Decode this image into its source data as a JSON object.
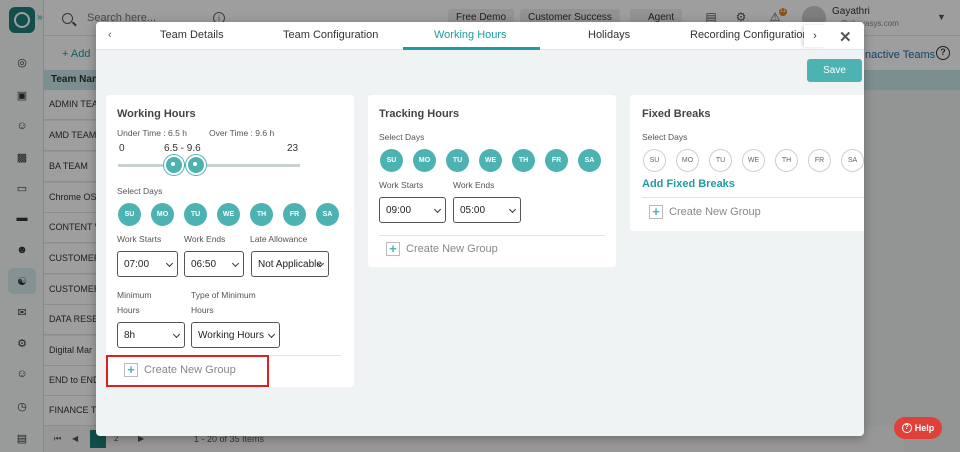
{
  "app": {
    "search_placeholder": "Search here...",
    "top_pills": [
      "Free Demo",
      "Customer Success",
      "Agent"
    ],
    "notif_count": "11",
    "user_name": "Gayathri",
    "user_email": "@shavasys.com",
    "add_label": "+ Add",
    "inactive_link": "Inactive Teams",
    "table_header": "Team Name",
    "rows": [
      "ADMIN TEAM",
      "AMD TEAM",
      "BA TEAM",
      "Chrome OS",
      "CONTENT W",
      "CUSTOMER",
      "CUSTOMER",
      "DATA RESEA",
      "Digital Mar",
      "END to END",
      "FINANCE TE"
    ],
    "pager": {
      "page1": "1",
      "page2": "2",
      "info": "1 - 20 of 35 Items"
    },
    "help_label": "Help"
  },
  "modal": {
    "tabs": [
      "Team Details",
      "Team Configuration",
      "Working Hours",
      "Holidays",
      "Recording Configuration"
    ],
    "active_tab": "Working Hours",
    "save_label": "Save",
    "working": {
      "title": "Working Hours",
      "under_time": "Under Time : 6.5 h",
      "over_time": "Over Time : 9.6 h",
      "slider_min": "0",
      "slider_range": "6.5 - 9.6",
      "slider_max": "23",
      "select_days": "Select Days",
      "days": [
        "SU",
        "MO",
        "TU",
        "WE",
        "TH",
        "FR",
        "SA"
      ],
      "work_starts_label": "Work Starts",
      "work_ends_label": "Work Ends",
      "late_label": "Late Allowance",
      "work_starts": "07:00",
      "work_ends": "06:50",
      "late": "Not Applicable",
      "min_hours_label_1": "Minimum",
      "min_hours_label_2": "Hours",
      "type_min_label_1": "Type of Minimum",
      "type_min_label_2": "Hours",
      "min_hours": "8h",
      "type_min": "Working Hours",
      "create_group": "Create New Group"
    },
    "tracking": {
      "title": "Tracking Hours",
      "select_days": "Select Days",
      "days": [
        "SU",
        "MO",
        "TU",
        "WE",
        "TH",
        "FR",
        "SA"
      ],
      "work_starts_label": "Work Starts",
      "work_ends_label": "Work Ends",
      "work_starts": "09:00",
      "work_ends": "05:00",
      "create_group": "Create New Group"
    },
    "fixed": {
      "title": "Fixed Breaks",
      "select_days": "Select Days",
      "days": [
        "SU",
        "MO",
        "TU",
        "WE",
        "TH",
        "FR",
        "SA"
      ],
      "add_label": "Add Fixed Breaks",
      "create_group": "Create New Group"
    }
  },
  "colors": {
    "accent": "#4db3b2",
    "brand": "#1e7f7a",
    "highlight": "#e02020",
    "help": "#e0403a"
  }
}
